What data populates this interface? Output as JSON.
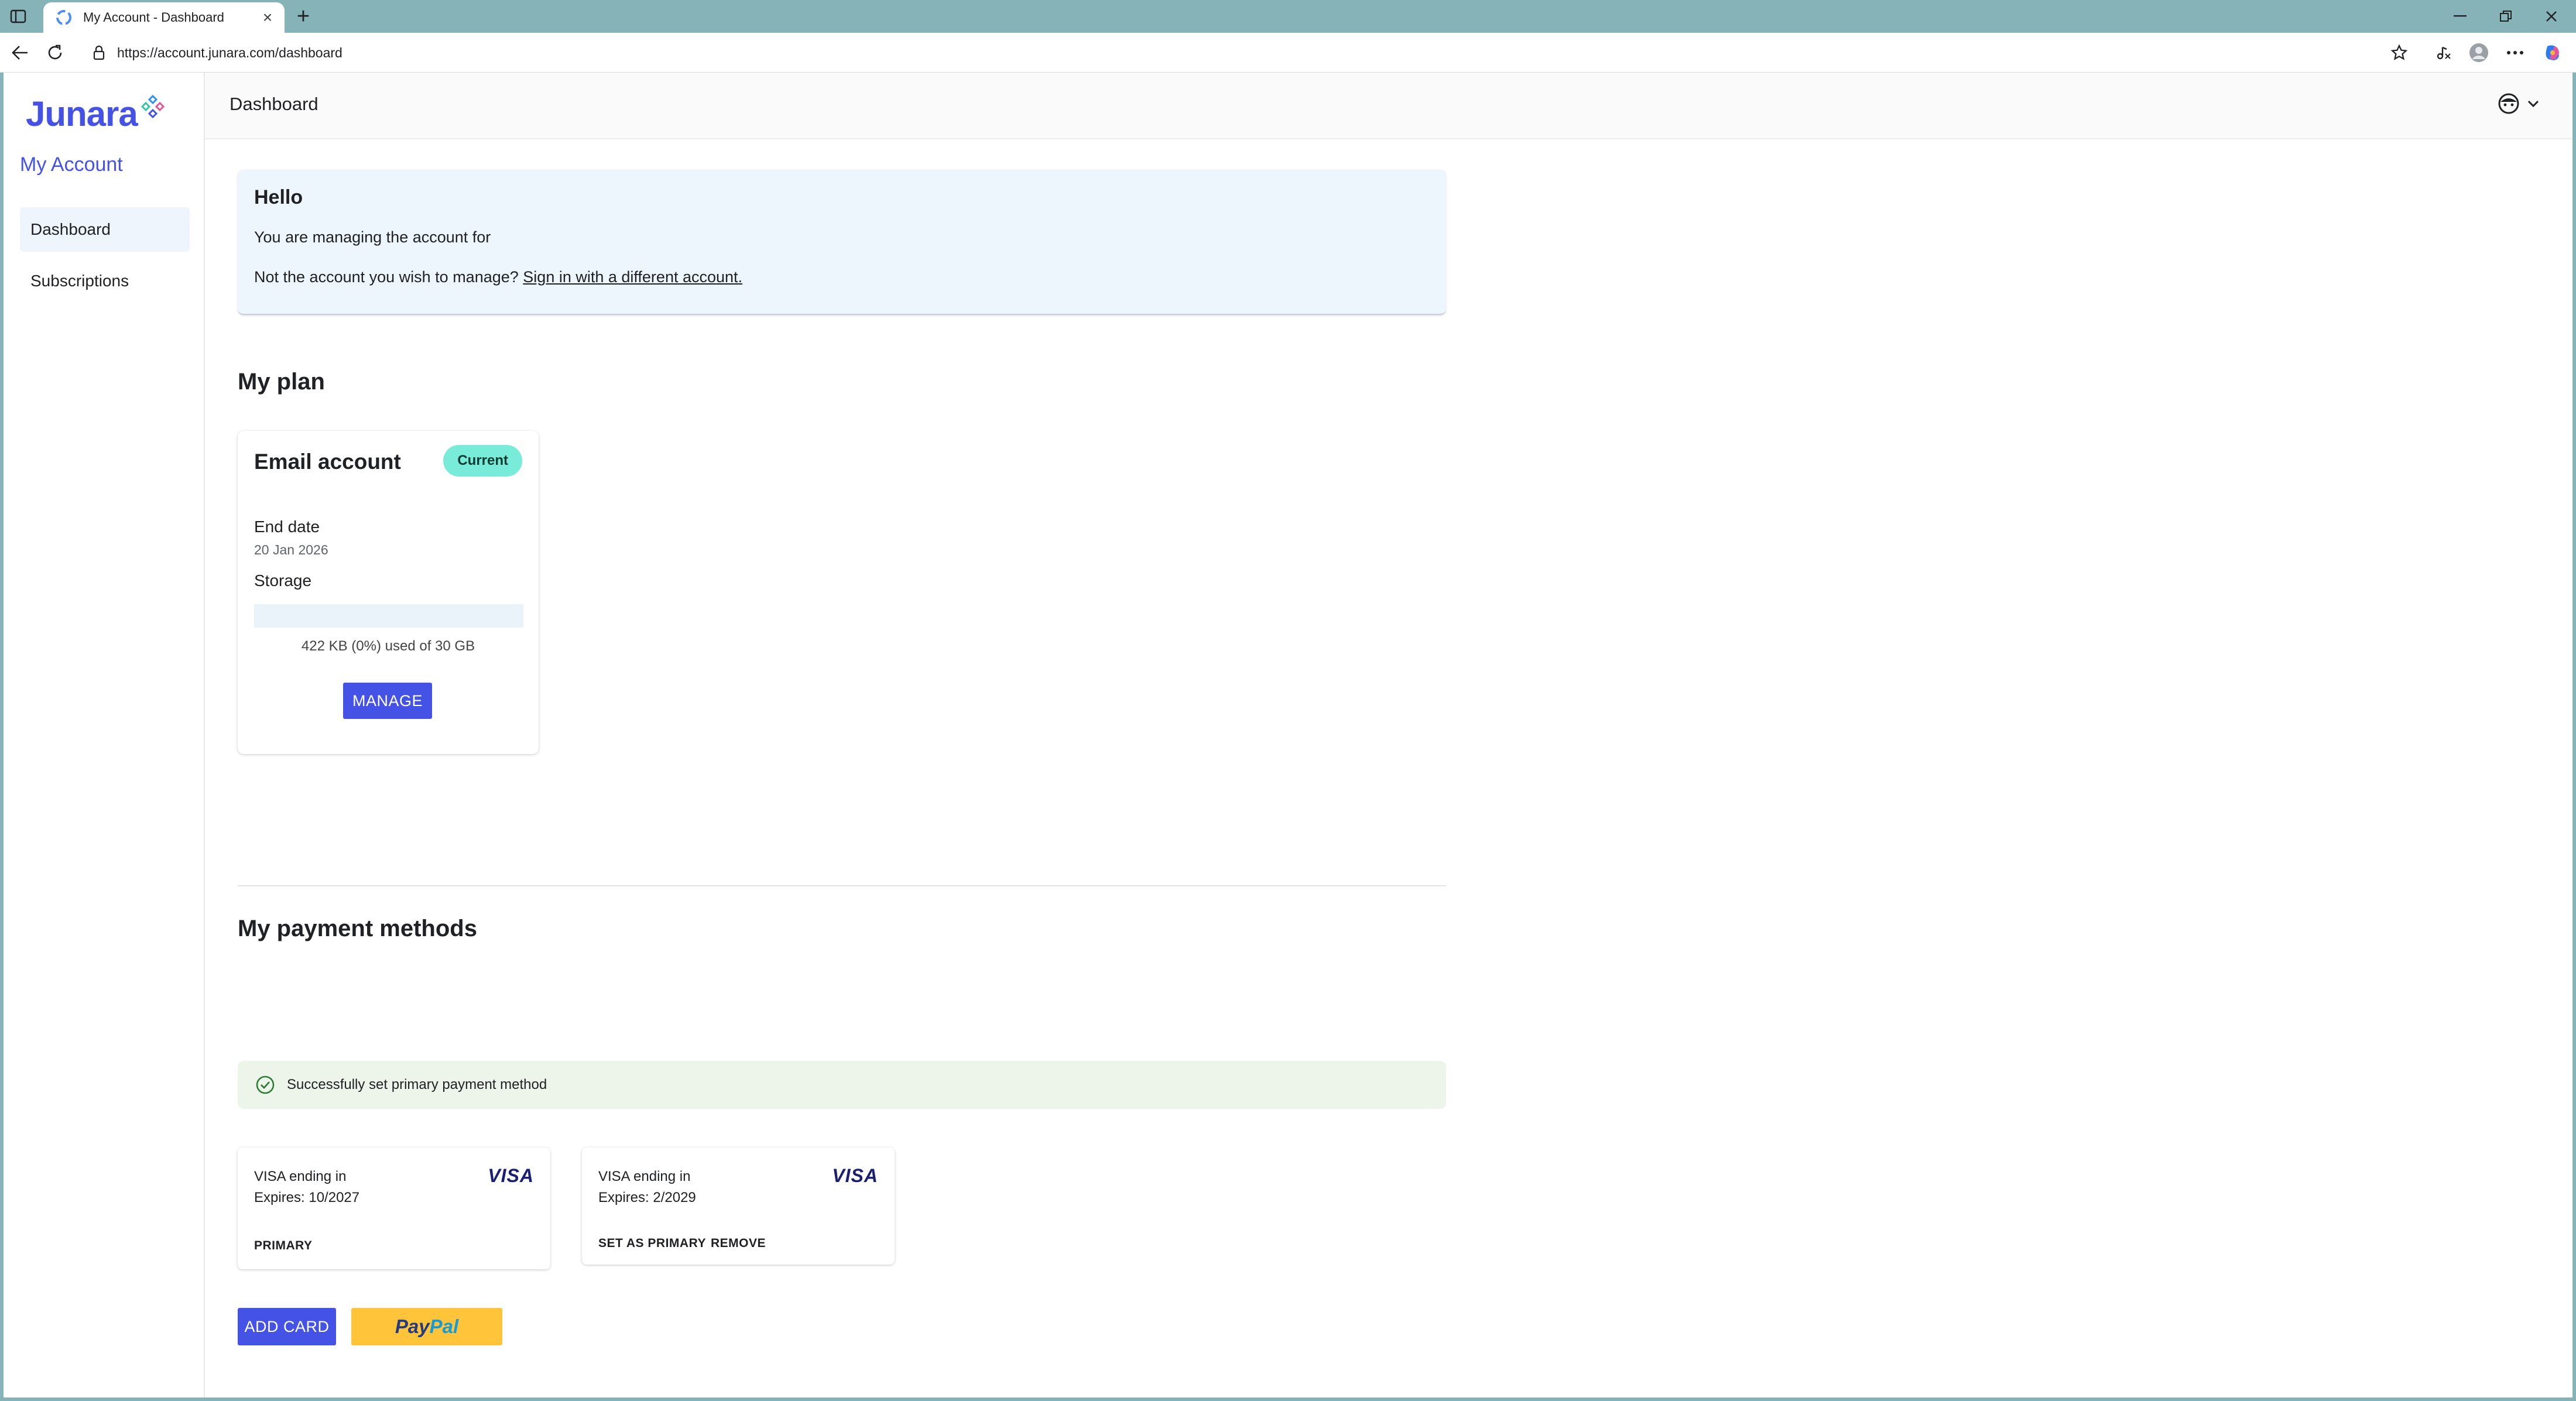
{
  "browser": {
    "tab_title": "My Account - Dashboard",
    "url": "https://account.junara.com/dashboard",
    "new_tab_label": "+",
    "close_tab_label": "×"
  },
  "brand": {
    "logo_text": "Junara",
    "accent_color": "#4552e6"
  },
  "sidebar": {
    "heading": "My Account",
    "items": [
      {
        "label": "Dashboard",
        "active": true
      },
      {
        "label": "Subscriptions",
        "active": false
      }
    ]
  },
  "header": {
    "title": "Dashboard"
  },
  "hello": {
    "title": "Hello",
    "managing_text": "You are managing the account for",
    "not_account_text": "Not the account you wish to manage?",
    "sign_in_link": "Sign in with a different account."
  },
  "plan": {
    "section_title": "My plan",
    "name": "Email account",
    "badge": "Current",
    "end_date_label": "End date",
    "end_date_value": "20 Jan 2026",
    "storage_label": "Storage",
    "storage_used_fraction": 0,
    "storage_text": "422 KB (0%) used of 30 GB",
    "manage_label": "MANAGE"
  },
  "payment": {
    "section_title": "My payment methods",
    "success_message": "Successfully set primary payment method",
    "cards": [
      {
        "title": "VISA  ending in",
        "expires": "Expires: 10/2027",
        "brand": "VISA",
        "actions": [
          "PRIMARY"
        ]
      },
      {
        "title": "VISA  ending in",
        "expires": "Expires: 2/2029",
        "brand": "VISA",
        "actions": [
          "SET AS PRIMARY",
          "REMOVE"
        ]
      }
    ],
    "add_card_label": "ADD CARD",
    "paypal_pay": "Pay",
    "paypal_pal": "Pal"
  }
}
